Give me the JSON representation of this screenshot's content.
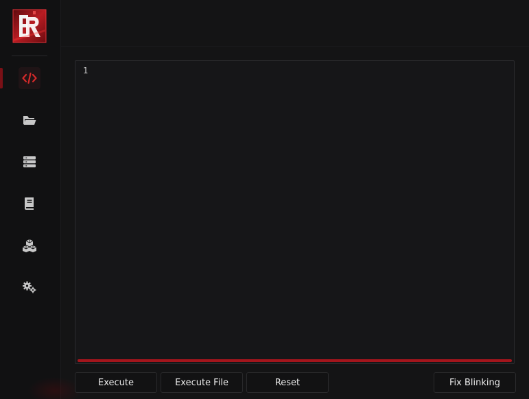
{
  "editor": {
    "line_numbers": [
      "1"
    ],
    "content": ""
  },
  "nav": {
    "items": [
      {
        "icon": "code-icon",
        "active": true
      },
      {
        "icon": "folder-open-icon",
        "active": false
      },
      {
        "icon": "server-list-icon",
        "active": false
      },
      {
        "icon": "book-icon",
        "active": false
      },
      {
        "icon": "cubes-icon",
        "active": false
      },
      {
        "icon": "gears-icon",
        "active": false
      }
    ]
  },
  "buttons": {
    "execute": "Execute",
    "execute_file": "Execute File",
    "reset": "Reset",
    "fix_blinking": "Fix Blinking"
  },
  "colors": {
    "accent": "#a3151c",
    "icon_default": "#c8c8c8",
    "icon_active": "#d42a2a"
  }
}
